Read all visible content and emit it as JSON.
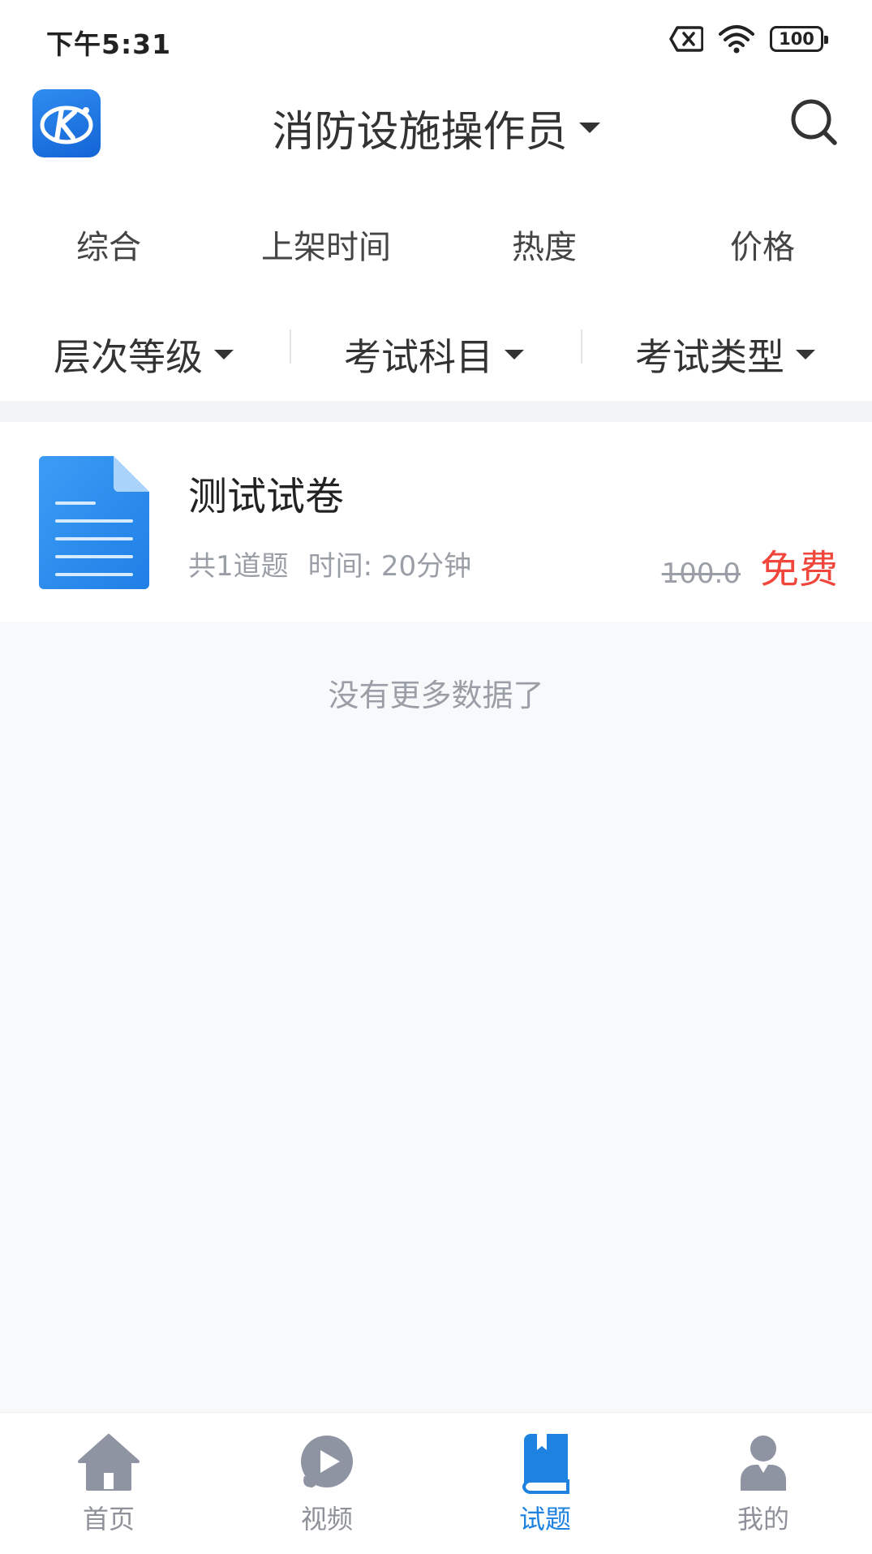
{
  "status_bar": {
    "time": "下午5:31",
    "battery": "100"
  },
  "header": {
    "title": "消防设施操作员"
  },
  "sort_tabs": [
    {
      "label": "综合"
    },
    {
      "label": "上架时间"
    },
    {
      "label": "热度"
    },
    {
      "label": "价格"
    }
  ],
  "filters": [
    {
      "label": "层次等级"
    },
    {
      "label": "考试科目"
    },
    {
      "label": "考试类型"
    }
  ],
  "list": [
    {
      "title": "测试试卷",
      "question_count": "共1道题",
      "duration": "时间: 20分钟",
      "original_price": "100.0",
      "price": "免费"
    }
  ],
  "list_footer": "没有更多数据了",
  "bottom_nav": [
    {
      "label": "首页",
      "icon": "home-icon",
      "active": false
    },
    {
      "label": "视频",
      "icon": "video-play-icon",
      "active": false
    },
    {
      "label": "试题",
      "icon": "book-icon",
      "active": true
    },
    {
      "label": "我的",
      "icon": "user-icon",
      "active": false
    }
  ],
  "colors": {
    "accent": "#1d82e0",
    "price_red": "#f0463c",
    "muted_text": "#9a9ea6"
  }
}
